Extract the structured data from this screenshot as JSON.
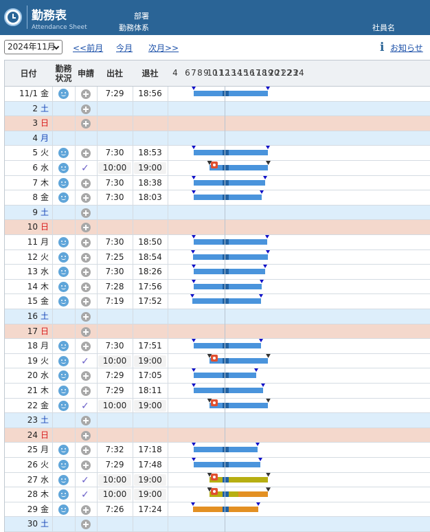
{
  "header": {
    "title": "勤務表",
    "subtitle": "Attendance Sheet",
    "department_label": "部署",
    "work_system_label": "勤務体系",
    "employee_label": "社員名"
  },
  "toolbar": {
    "month_value": "2024年11月",
    "prev_label": "<<前月",
    "current_label": "今月",
    "next_label": "次月>>",
    "notice_label": "お知らせ",
    "info_icon": "info-icon"
  },
  "table": {
    "columns": [
      "日付",
      "勤務状況",
      "申請",
      "出社",
      "退社"
    ],
    "status_header_line1": "勤務",
    "status_header_line2": "状況",
    "hours": [
      "4",
      "6",
      "8",
      "10",
      "12",
      "14",
      "16",
      "18",
      "20",
      "22",
      "24",
      "2",
      "4",
      "6",
      "8",
      "10",
      "12",
      "14",
      "16",
      "18",
      "20",
      "22",
      "24"
    ],
    "hour_labels": [
      "4",
      "6",
      "7",
      "8",
      "9",
      "10",
      "11",
      "12",
      "13",
      "14",
      "15",
      "16",
      "17",
      "18",
      "19",
      "20",
      "21",
      "22",
      "23",
      "24"
    ],
    "colors": {
      "planned": "#4a94dc",
      "core": "#2162a3",
      "olive": "#b7af12",
      "orange": "#e39023",
      "saturday_bg": "#ddeefb",
      "sunday_bg": "#f4d8cc"
    },
    "rows": [
      {
        "date": "11/1",
        "weekday": "金",
        "type": "work",
        "request": "plus",
        "in": "7:29",
        "out": "18:56",
        "start": 7.0,
        "end": 19.0,
        "segments": [
          {
            "from": 7.0,
            "to": 19.0,
            "color": "planned"
          }
        ]
      },
      {
        "date": "2",
        "weekday": "土",
        "type": "sat",
        "request": "plus",
        "in": "",
        "out": ""
      },
      {
        "date": "3",
        "weekday": "日",
        "type": "sun",
        "request": "plus",
        "in": "",
        "out": ""
      },
      {
        "date": "4",
        "weekday": "月",
        "type": "sat",
        "request": "",
        "in": "",
        "out": ""
      },
      {
        "date": "5",
        "weekday": "火",
        "type": "work",
        "request": "plus",
        "in": "7:30",
        "out": "18:53",
        "start": 7.0,
        "end": 19.0,
        "segments": [
          {
            "from": 7.0,
            "to": 19.0,
            "color": "planned"
          }
        ]
      },
      {
        "date": "6",
        "weekday": "水",
        "type": "work",
        "request": "check",
        "in": "10:00",
        "out": "19:00",
        "boxed": true,
        "start": 9.5,
        "end": 19.0,
        "flag": true,
        "segments": [
          {
            "from": 9.5,
            "to": 19.0,
            "color": "planned"
          }
        ]
      },
      {
        "date": "7",
        "weekday": "木",
        "type": "work",
        "request": "plus",
        "in": "7:30",
        "out": "18:38",
        "start": 7.0,
        "end": 18.6,
        "segments": [
          {
            "from": 7.0,
            "to": 18.6,
            "color": "planned"
          }
        ]
      },
      {
        "date": "8",
        "weekday": "金",
        "type": "work",
        "request": "plus",
        "in": "7:30",
        "out": "18:03",
        "start": 7.0,
        "end": 18.0,
        "segments": [
          {
            "from": 7.0,
            "to": 18.0,
            "color": "planned"
          }
        ]
      },
      {
        "date": "9",
        "weekday": "土",
        "type": "sat",
        "request": "plus",
        "in": "",
        "out": ""
      },
      {
        "date": "10",
        "weekday": "日",
        "type": "sun",
        "request": "plus",
        "in": "",
        "out": ""
      },
      {
        "date": "11",
        "weekday": "月",
        "type": "work",
        "request": "plus",
        "in": "7:30",
        "out": "18:50",
        "start": 7.0,
        "end": 18.9,
        "segments": [
          {
            "from": 7.0,
            "to": 18.9,
            "color": "planned"
          }
        ]
      },
      {
        "date": "12",
        "weekday": "火",
        "type": "work",
        "request": "plus",
        "in": "7:25",
        "out": "18:54",
        "start": 6.9,
        "end": 19.0,
        "segments": [
          {
            "from": 6.9,
            "to": 19.0,
            "color": "planned"
          }
        ]
      },
      {
        "date": "13",
        "weekday": "水",
        "type": "work",
        "request": "plus",
        "in": "7:30",
        "out": "18:26",
        "start": 7.0,
        "end": 18.5,
        "segments": [
          {
            "from": 7.0,
            "to": 18.5,
            "color": "planned"
          }
        ]
      },
      {
        "date": "14",
        "weekday": "木",
        "type": "work",
        "request": "plus",
        "in": "7:28",
        "out": "17:56",
        "start": 7.0,
        "end": 18.0,
        "segments": [
          {
            "from": 7.0,
            "to": 18.0,
            "color": "planned"
          }
        ]
      },
      {
        "date": "15",
        "weekday": "金",
        "type": "work",
        "request": "plus",
        "in": "7:19",
        "out": "17:52",
        "start": 6.8,
        "end": 17.9,
        "segments": [
          {
            "from": 6.8,
            "to": 17.9,
            "color": "planned"
          }
        ]
      },
      {
        "date": "16",
        "weekday": "土",
        "type": "sat",
        "request": "plus",
        "in": "",
        "out": ""
      },
      {
        "date": "17",
        "weekday": "日",
        "type": "sun",
        "request": "plus",
        "in": "",
        "out": ""
      },
      {
        "date": "18",
        "weekday": "月",
        "type": "work",
        "request": "plus",
        "in": "7:30",
        "out": "17:51",
        "start": 7.0,
        "end": 17.9,
        "segments": [
          {
            "from": 7.0,
            "to": 17.9,
            "color": "planned"
          }
        ]
      },
      {
        "date": "19",
        "weekday": "火",
        "type": "work",
        "request": "check",
        "in": "10:00",
        "out": "19:00",
        "boxed": true,
        "start": 9.5,
        "end": 19.0,
        "flag": true,
        "segments": [
          {
            "from": 9.5,
            "to": 19.0,
            "color": "planned"
          }
        ]
      },
      {
        "date": "20",
        "weekday": "水",
        "type": "work",
        "request": "plus",
        "in": "7:29",
        "out": "17:05",
        "start": 7.0,
        "end": 17.1,
        "segments": [
          {
            "from": 7.0,
            "to": 17.1,
            "color": "planned"
          }
        ]
      },
      {
        "date": "21",
        "weekday": "木",
        "type": "work",
        "request": "plus",
        "in": "7:29",
        "out": "18:11",
        "start": 7.0,
        "end": 18.2,
        "segments": [
          {
            "from": 7.0,
            "to": 18.2,
            "color": "planned"
          }
        ]
      },
      {
        "date": "22",
        "weekday": "金",
        "type": "work",
        "request": "check",
        "in": "10:00",
        "out": "19:00",
        "boxed": true,
        "start": 9.5,
        "end": 19.0,
        "flag": true,
        "segments": [
          {
            "from": 9.5,
            "to": 19.0,
            "color": "planned"
          }
        ]
      },
      {
        "date": "23",
        "weekday": "土",
        "type": "sat",
        "request": "plus",
        "in": "",
        "out": ""
      },
      {
        "date": "24",
        "weekday": "日",
        "type": "sun",
        "request": "plus",
        "in": "",
        "out": ""
      },
      {
        "date": "25",
        "weekday": "月",
        "type": "work",
        "request": "plus",
        "in": "7:32",
        "out": "17:18",
        "start": 7.0,
        "end": 17.3,
        "segments": [
          {
            "from": 7.0,
            "to": 17.3,
            "color": "planned"
          }
        ]
      },
      {
        "date": "26",
        "weekday": "火",
        "type": "work",
        "request": "plus",
        "in": "7:29",
        "out": "17:48",
        "start": 7.0,
        "end": 17.8,
        "segments": [
          {
            "from": 7.0,
            "to": 17.8,
            "color": "planned"
          }
        ]
      },
      {
        "date": "27",
        "weekday": "水",
        "type": "work",
        "request": "check",
        "in": "10:00",
        "out": "19:00",
        "boxed": true,
        "start": 9.5,
        "end": 19.0,
        "flag": true,
        "segments": [
          {
            "from": 9.5,
            "to": 19.0,
            "color": "olive"
          }
        ]
      },
      {
        "date": "28",
        "weekday": "木",
        "type": "work",
        "request": "check",
        "in": "10:00",
        "out": "19:00",
        "boxed": true,
        "start": 9.5,
        "end": 19.0,
        "flag": true,
        "segments": [
          {
            "from": 9.5,
            "to": 14.2,
            "color": "olive"
          },
          {
            "from": 14.2,
            "to": 19.0,
            "color": "orange"
          }
        ]
      },
      {
        "date": "29",
        "weekday": "金",
        "type": "work",
        "request": "plus",
        "in": "7:26",
        "out": "17:24",
        "start": 6.9,
        "end": 17.4,
        "segments": [
          {
            "from": 6.9,
            "to": 17.4,
            "color": "orange"
          }
        ]
      },
      {
        "date": "30",
        "weekday": "土",
        "type": "sat",
        "request": "plus",
        "in": "",
        "out": ""
      }
    ]
  }
}
